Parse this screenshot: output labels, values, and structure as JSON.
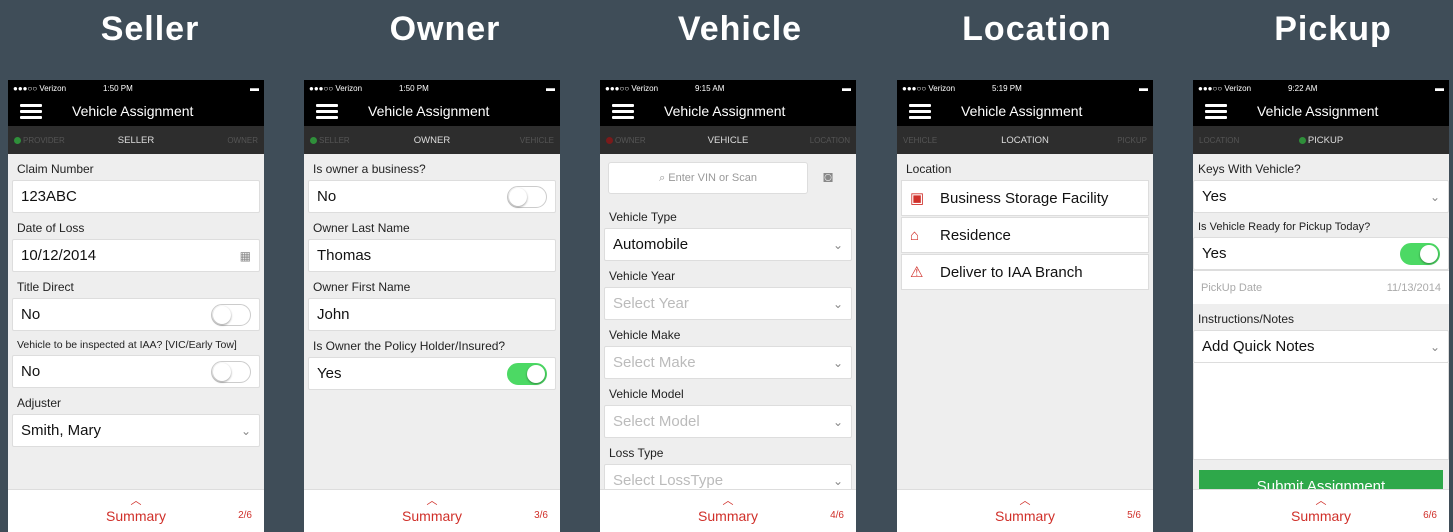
{
  "titles": [
    "Seller",
    "Owner",
    "Vehicle",
    "Location",
    "Pickup"
  ],
  "carrier": "●●●○○ Verizon",
  "app_title": "Vehicle Assignment",
  "summary_label": "Summary",
  "screens": {
    "seller": {
      "time": "1:50 PM",
      "steps": {
        "prev": "PROVIDER",
        "current": "SELLER",
        "next": "OWNER"
      },
      "claim_label": "Claim Number",
      "claim_value": "123ABC",
      "dol_label": "Date of Loss",
      "dol_value": "10/12/2014",
      "title_direct_label": "Title Direct",
      "title_direct_value": "No",
      "inspect_label": "Vehicle to be inspected at IAA? [VIC/Early Tow]",
      "inspect_value": "No",
      "adjuster_label": "Adjuster",
      "adjuster_value": "Smith, Mary",
      "page": "2/6"
    },
    "owner": {
      "time": "1:50 PM",
      "steps": {
        "prev": "SELLER",
        "current": "OWNER",
        "next": "VEHICLE"
      },
      "business_label": "Is owner a business?",
      "business_value": "No",
      "last_label": "Owner Last Name",
      "last_value": "Thomas",
      "first_label": "Owner First Name",
      "first_value": "John",
      "policy_label": "Is Owner the Policy Holder/Insured?",
      "policy_value": "Yes",
      "page": "3/6"
    },
    "vehicle": {
      "time": "9:15 AM",
      "steps": {
        "prev": "OWNER",
        "current": "VEHICLE",
        "next": "LOCATION"
      },
      "search_placeholder": "Enter VIN or Scan",
      "type_label": "Vehicle Type",
      "type_value": "Automobile",
      "year_label": "Vehicle Year",
      "year_value": "Select Year",
      "make_label": "Vehicle Make",
      "make_value": "Select Make",
      "model_label": "Vehicle Model",
      "model_value": "Select Model",
      "loss_label": "Loss Type",
      "loss_value": "Select LossType",
      "page": "4/6"
    },
    "location": {
      "time": "5:19 PM",
      "steps": {
        "prev": "VEHICLE",
        "current": "LOCATION",
        "next": "PICKUP"
      },
      "section_label": "Location",
      "items": [
        "Business Storage Facility",
        "Residence",
        "Deliver to IAA Branch"
      ],
      "page": "5/6"
    },
    "pickup": {
      "time": "9:22 AM",
      "steps": {
        "prev": "LOCATION",
        "current": "PICKUP",
        "next": ""
      },
      "keys_label": "Keys With Vehicle?",
      "keys_value": "Yes",
      "ready_label": "Is Vehicle Ready for Pickup Today?",
      "ready_value": "Yes",
      "date_label": "PickUp Date",
      "date_value": "11/13/2014",
      "notes_label": "Instructions/Notes",
      "notes_value": "Add Quick Notes",
      "submit_label": "Submit Assignment",
      "page": "6/6"
    }
  }
}
